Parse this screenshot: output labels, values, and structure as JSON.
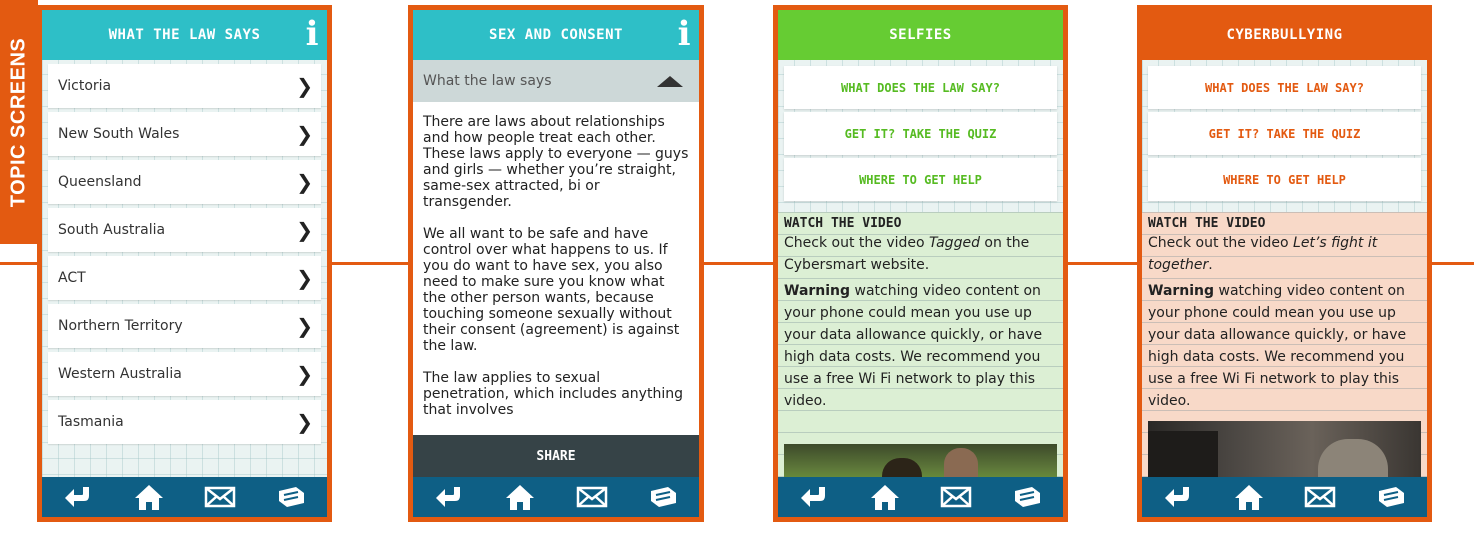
{
  "side_label": "TOPIC SCREENS",
  "screen1": {
    "title": "WHAT THE LAW SAYS",
    "items": [
      "Victoria",
      "New South Wales",
      "Queensland",
      "South Australia",
      "ACT",
      "Northern Territory",
      "Western Australia",
      "Tasmania"
    ]
  },
  "screen2": {
    "title": "SEX AND CONSENT",
    "accordion_label": "What the law says",
    "paragraphs": [
      "There are laws about relationships and how people treat each other. These laws apply to everyone — guys and girls — whether you’re straight, same-sex attracted, bi or transgender.",
      "We all want to be safe and have control over what happens to us. If you do want to have sex, you also need to make sure you know what the other person wants, because touching someone sexually without their consent (agreement) is against the law.",
      "The law applies to sexual penetration, which includes anything that involves"
    ],
    "share": "SHARE"
  },
  "screen3": {
    "title": "SELFIES",
    "menu": [
      "WHAT DOES THE LAW SAY?",
      "GET IT? TAKE THE QUIZ",
      "WHERE TO GET HELP"
    ],
    "watch_title": "WATCH THE VIDEO",
    "video_intro": "Check out the video",
    "video_name": "Tagged",
    "video_after": "on the Cybersmart website.",
    "warning_label": "Warning",
    "warning_text": "watching video content on your phone could mean you use up your data allowance quickly, or have high data costs. We recommend you use a free Wi Fi network to play this video."
  },
  "screen4": {
    "title": "CYBERBULLYING",
    "menu": [
      "WHAT DOES THE LAW SAY?",
      "GET IT? TAKE THE QUIZ",
      "WHERE TO GET HELP"
    ],
    "watch_title": "WATCH THE VIDEO",
    "video_intro": "Check out the video",
    "video_name": "Let’s fight it together",
    "video_after": ".",
    "warning_label": "Warning",
    "warning_text": "watching video content on your phone could mean you use up your data allowance quickly, or have high data costs. We recommend you use a free Wi Fi network to play this video."
  },
  "icons": [
    "back-icon",
    "home-icon",
    "mail-icon",
    "share-icon",
    "info-icon",
    "chevron-right-icon",
    "chevron-up-icon",
    "play-icon"
  ],
  "colors": {
    "orange": "#e35a11",
    "teal": "#2ebfc7",
    "green": "#66cc33",
    "navy": "#0e5f85",
    "dark": "#364347"
  }
}
